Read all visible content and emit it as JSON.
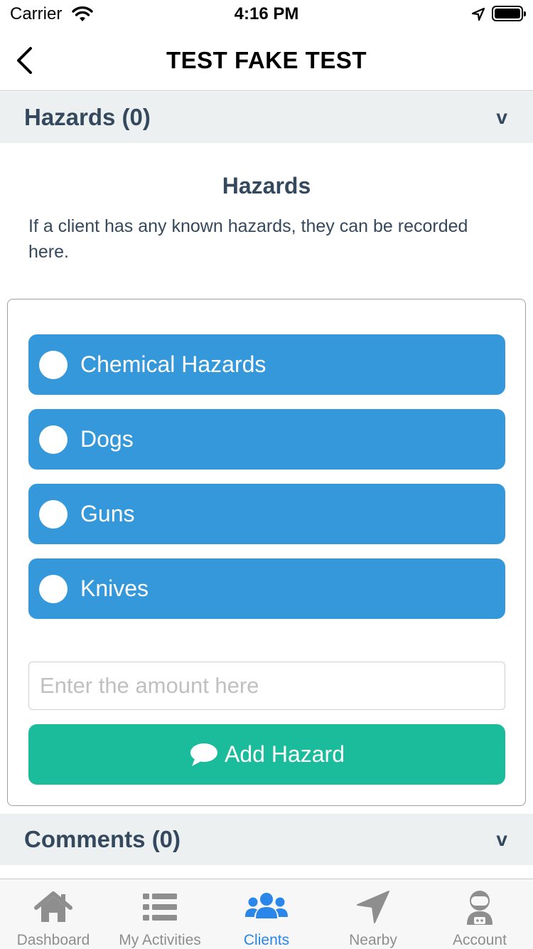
{
  "status_bar": {
    "carrier": "Carrier",
    "time": "4:16 PM"
  },
  "nav": {
    "title": "TEST FAKE TEST"
  },
  "hazards_section": {
    "header": "Hazards (0)",
    "chevron": "v",
    "heading": "Hazards",
    "description": "If a client has any known hazards, they can be recorded here.",
    "options": [
      {
        "label": "Chemical Hazards"
      },
      {
        "label": "Dogs"
      },
      {
        "label": "Guns"
      },
      {
        "label": "Knives"
      }
    ],
    "amount_placeholder": "Enter the amount here",
    "add_button": "Add Hazard"
  },
  "comments_section": {
    "header": "Comments (0)",
    "chevron": "v"
  },
  "tabs": [
    {
      "label": "Dashboard",
      "icon": "home-icon",
      "active": false
    },
    {
      "label": "My Activities",
      "icon": "list-icon",
      "active": false
    },
    {
      "label": "Clients",
      "icon": "users-icon",
      "active": true
    },
    {
      "label": "Nearby",
      "icon": "location-arrow-icon",
      "active": false
    },
    {
      "label": "Account",
      "icon": "astronaut-icon",
      "active": false
    }
  ],
  "colors": {
    "option_blue": "#3498db",
    "add_green": "#1abc9c",
    "section_bg": "#ecf0f1",
    "text_dark": "#34495e",
    "tab_active": "#2a86e8",
    "tab_inactive": "#8e8e8e"
  }
}
